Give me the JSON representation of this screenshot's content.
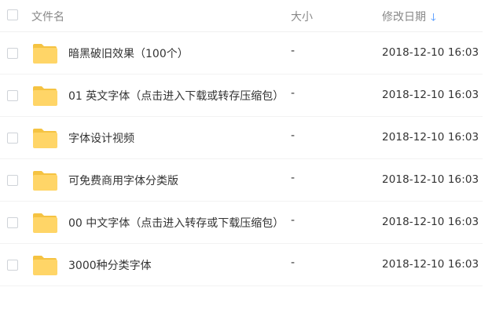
{
  "header": {
    "name_label": "文件名",
    "size_label": "大小",
    "date_label": "修改日期",
    "sort_icon": "arrow-down-icon"
  },
  "colors": {
    "folder": "#ffd567",
    "folder_tab": "#f5c342",
    "accent": "#3b8cff"
  },
  "files": [
    {
      "name": "暗黑破旧效果（100个）",
      "size": "-",
      "date": "2018-12-10 16:03"
    },
    {
      "name": "01 英文字体（点击进入下载或转存压缩包）",
      "size": "-",
      "date": "2018-12-10 16:03"
    },
    {
      "name": "字体设计视频",
      "size": "-",
      "date": "2018-12-10 16:03"
    },
    {
      "name": "可免费商用字体分类版",
      "size": "-",
      "date": "2018-12-10 16:03"
    },
    {
      "name": "00 中文字体（点击进入转存或下载压缩包）",
      "size": "-",
      "date": "2018-12-10 16:03"
    },
    {
      "name": "3000种分类字体",
      "size": "-",
      "date": "2018-12-10 16:03"
    }
  ]
}
